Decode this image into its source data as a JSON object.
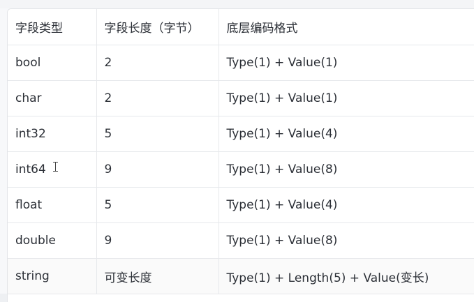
{
  "table": {
    "headers": [
      "字段类型",
      "字段长度（字节）",
      "底层编码格式"
    ],
    "rows": [
      [
        "bool",
        "2",
        "Type(1) + Value(1)"
      ],
      [
        "char",
        "2",
        "Type(1) + Value(1)"
      ],
      [
        "int32",
        "5",
        "Type(1) + Value(4)"
      ],
      [
        "int64",
        "9",
        "Type(1) + Value(8)"
      ],
      [
        "float",
        "5",
        "Type(1) + Value(4)"
      ],
      [
        "double",
        "9",
        "Type(1) + Value(8)"
      ],
      [
        "string",
        "可变长度",
        "Type(1) + Length(5) + Value(变长)"
      ]
    ]
  }
}
